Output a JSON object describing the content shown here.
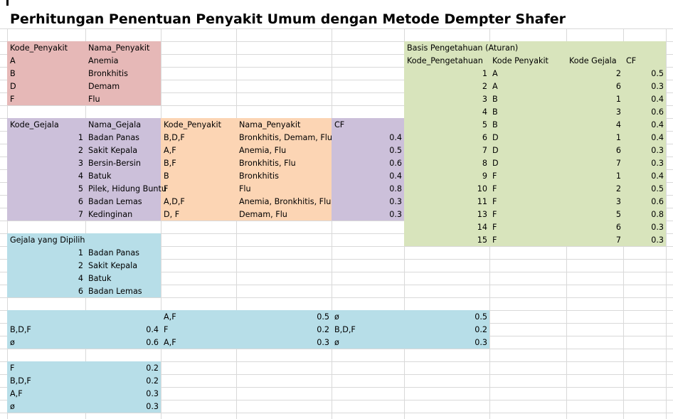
{
  "title": "Perhitungan Penentuan Penyakit Umum dengan Metode Dempter Shafer",
  "colors": {
    "pink": "#e6b8b7",
    "purple": "#ccc0da",
    "orange": "#fcd5b4",
    "green": "#d8e4bc",
    "blue": "#b7dee8",
    "grid": "#d9d9d9"
  },
  "penyakit": {
    "headers": [
      "Kode_Penyakit",
      "Nama_Penyakit"
    ],
    "rows": [
      [
        "A",
        "Anemia"
      ],
      [
        "B",
        "Bronkhitis"
      ],
      [
        "D",
        "Demam"
      ],
      [
        "F",
        "Flu"
      ]
    ]
  },
  "gejala": {
    "headers": [
      "Kode_Gejala",
      "Nama_Gejala",
      "Kode_Penyakit",
      "Nama_Penyakit",
      "CF"
    ],
    "rows": [
      [
        "1",
        "Badan Panas",
        "B,D,F",
        "Bronkhitis, Demam, Flu",
        "0.4"
      ],
      [
        "2",
        "Sakit Kepala",
        "A,F",
        "Anemia, Flu",
        "0.5"
      ],
      [
        "3",
        "Bersin-Bersin",
        "B,F",
        "Bronkhitis, Flu",
        "0.6"
      ],
      [
        "4",
        "Batuk",
        "B",
        "Bronkhitis",
        "0.4"
      ],
      [
        "5",
        "Pilek, Hidung Buntu",
        "F",
        "Flu",
        "0.8"
      ],
      [
        "6",
        "Badan Lemas",
        "A,D,F",
        "Anemia, Bronkhitis, Flu",
        "0.3"
      ],
      [
        "7",
        "Kedinginan",
        "D, F",
        "Demam, Flu",
        "0.3"
      ]
    ]
  },
  "basis": {
    "title": "Basis Pengetahuan (Aturan)",
    "headers": [
      "Kode_Pengetahuan",
      "Kode Penyakit",
      "Kode Gejala",
      "CF"
    ],
    "rows": [
      [
        "1",
        "A",
        "2",
        "0.5"
      ],
      [
        "2",
        "A",
        "6",
        "0.3"
      ],
      [
        "3",
        "B",
        "1",
        "0.4"
      ],
      [
        "4",
        "B",
        "3",
        "0.6"
      ],
      [
        "5",
        "B",
        "4",
        "0.4"
      ],
      [
        "6",
        "D",
        "1",
        "0.4"
      ],
      [
        "7",
        "D",
        "6",
        "0.3"
      ],
      [
        "8",
        "D",
        "7",
        "0.3"
      ],
      [
        "9",
        "F",
        "1",
        "0.4"
      ],
      [
        "10",
        "F",
        "2",
        "0.5"
      ],
      [
        "11",
        "F",
        "3",
        "0.6"
      ],
      [
        "13",
        "F",
        "5",
        "0.8"
      ],
      [
        "14",
        "F",
        "6",
        "0.3"
      ],
      [
        "15",
        "F",
        "7",
        "0.3"
      ]
    ]
  },
  "dipilih": {
    "title": "Gejala yang Dipilih",
    "rows": [
      [
        "1",
        "Badan Panas"
      ],
      [
        "2",
        "Sakit Kepala"
      ],
      [
        "4",
        "Batuk"
      ],
      [
        "6",
        "Badan Lemas"
      ]
    ]
  },
  "kombinasi": {
    "rows": [
      [
        "",
        "",
        "A,F",
        "0.5",
        "ø",
        "0.5"
      ],
      [
        "B,D,F",
        "0.4",
        "F",
        "0.2",
        "B,D,F",
        "0.2"
      ],
      [
        "ø",
        "0.6",
        "A,F",
        "0.3",
        "ø",
        "0.3"
      ]
    ]
  },
  "hasil": {
    "rows": [
      [
        "F",
        "0.2"
      ],
      [
        "B,D,F",
        "0.2"
      ],
      [
        "A,F",
        "0.3"
      ],
      [
        "ø",
        "0.3"
      ]
    ]
  }
}
